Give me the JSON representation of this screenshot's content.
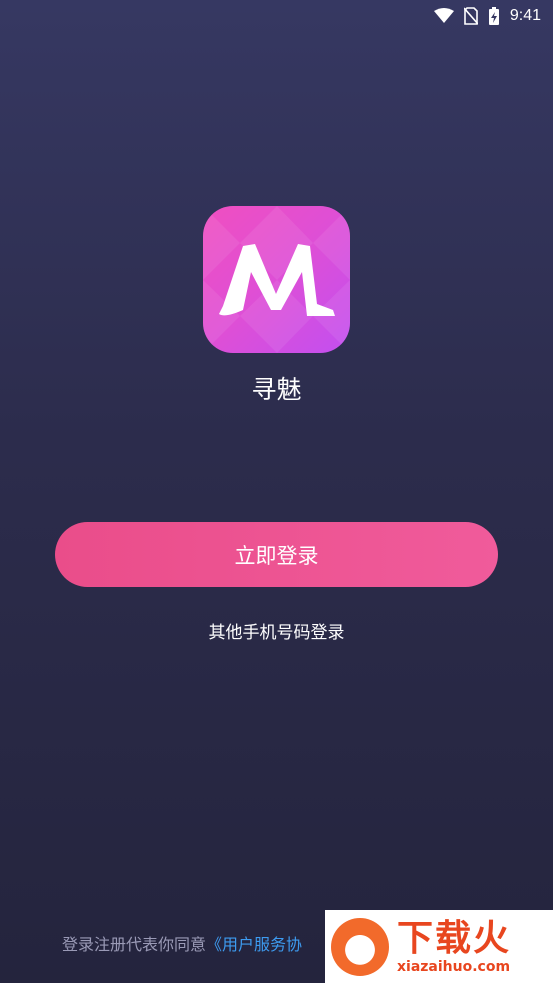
{
  "status_bar": {
    "time": "9:41",
    "icons": [
      "wifi-icon",
      "no-sim-icon",
      "battery-charging-icon"
    ]
  },
  "app": {
    "name": "寻魅",
    "logo_letter": "M",
    "icon_gradient": [
      "#f04fc0",
      "#c24ff0"
    ]
  },
  "login": {
    "button_label": "立即登录",
    "other_label": "其他手机号码登录",
    "button_color": "#ee5592"
  },
  "agreement": {
    "prefix": "登录注册代表你同意",
    "link": "《用户服务协",
    "link_color": "#3d9bf0"
  },
  "watermark": {
    "title": "下载火",
    "url": "xiazaihuo.com"
  }
}
